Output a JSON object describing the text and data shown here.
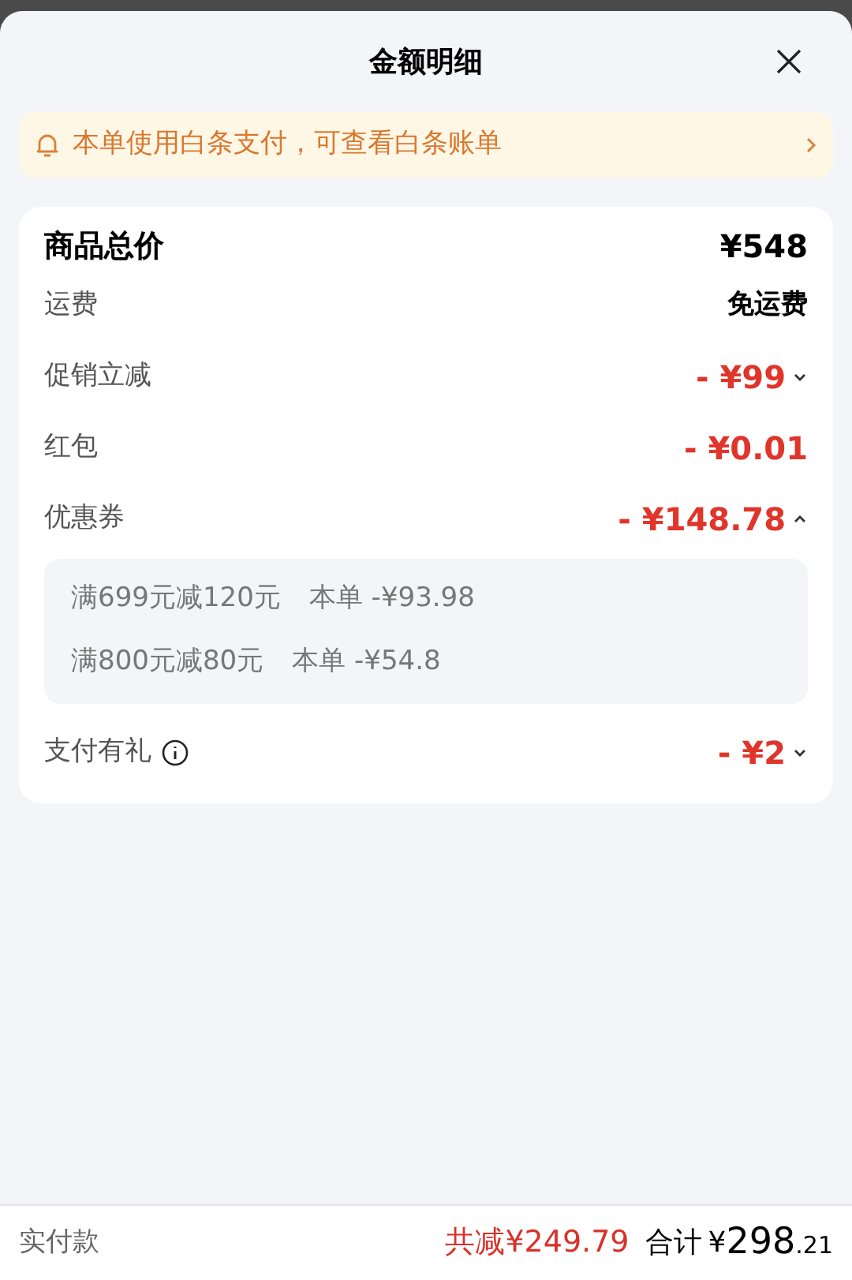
{
  "sheet": {
    "title": "金额明细"
  },
  "notice": {
    "text": "本单使用白条支付，可查看白条账单"
  },
  "rows": [
    {
      "kind": "total",
      "label": "商品总价",
      "amount": "¥548"
    },
    {
      "kind": "plain",
      "label": "运费",
      "amount": "免运费"
    },
    {
      "kind": "discount",
      "label": "促销立减",
      "amount": "- ¥99",
      "expanded": false
    },
    {
      "kind": "discount",
      "label": "红包",
      "amount": "- ¥0.01"
    },
    {
      "kind": "discount",
      "label": "优惠券",
      "amount": "- ¥148.78",
      "expanded": true,
      "details": [
        {
          "rule": "满699元减120元",
          "share": "本单 -¥93.98"
        },
        {
          "rule": "满800元减80元",
          "share": "本单 -¥54.8"
        }
      ]
    },
    {
      "kind": "discount",
      "label": "支付有礼",
      "amount": "- ¥2",
      "expanded": false,
      "info": true
    }
  ],
  "footer": {
    "label": "实付款",
    "saved": "共减¥249.79",
    "total_label": "合计",
    "currency": "¥",
    "total_int": "298",
    "total_dec": ".21"
  }
}
